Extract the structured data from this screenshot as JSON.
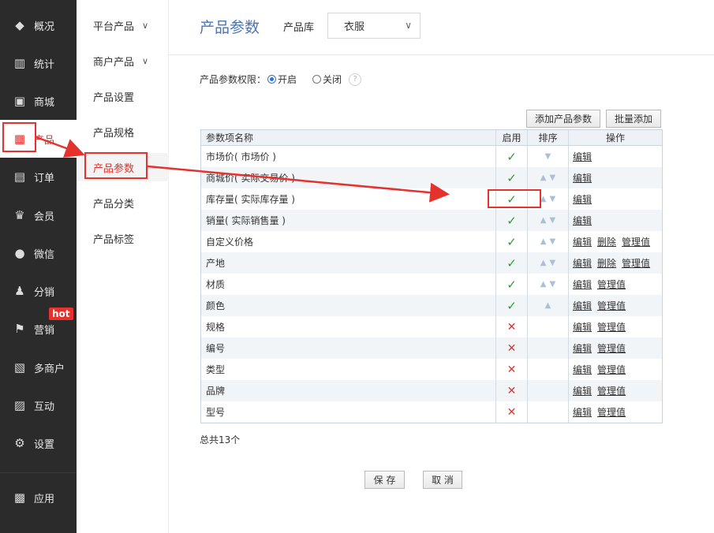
{
  "nav": {
    "items": [
      {
        "label": "概况",
        "icon": "layers-icon",
        "glyph": "◆"
      },
      {
        "label": "统计",
        "icon": "bar-chart-icon",
        "glyph": "▥"
      },
      {
        "label": "商城",
        "icon": "store-icon",
        "glyph": "▣"
      },
      {
        "label": "产品",
        "icon": "grid-icon",
        "glyph": "▦"
      },
      {
        "label": "订单",
        "icon": "order-icon",
        "glyph": "▤"
      },
      {
        "label": "会员",
        "icon": "crown-icon",
        "glyph": "♛"
      },
      {
        "label": "微信",
        "icon": "chat-icon",
        "glyph": "●"
      },
      {
        "label": "分销",
        "icon": "users-icon",
        "glyph": "♟"
      },
      {
        "label": "营销",
        "icon": "flag-icon",
        "glyph": "⚑"
      },
      {
        "label": "多商户",
        "icon": "merchant-icon",
        "glyph": "▧"
      },
      {
        "label": "互动",
        "icon": "interact-icon",
        "glyph": "▨"
      },
      {
        "label": "设置",
        "icon": "gear-icon",
        "glyph": "⚙"
      },
      {
        "label": "应用",
        "icon": "apps-icon",
        "glyph": "▩"
      }
    ],
    "hot_badge": "hot"
  },
  "subnav": {
    "items": [
      {
        "label": "平台产品",
        "chevron": "∨"
      },
      {
        "label": "商户产品",
        "chevron": "∨"
      },
      {
        "label": "产品设置"
      },
      {
        "label": "产品规格"
      },
      {
        "label": "产品参数"
      },
      {
        "label": "产品分类"
      },
      {
        "label": "产品标签"
      }
    ]
  },
  "header": {
    "title": "产品参数",
    "library_label": "产品库",
    "library_value": "衣服",
    "library_chevron": "∨"
  },
  "permission": {
    "label": "产品参数权限：",
    "on_label": "开启",
    "off_label": "关闭",
    "help": "?"
  },
  "toolbar": {
    "add_label": "添加产品参数",
    "batch_label": "批量添加"
  },
  "table": {
    "headers": [
      "参数项名称",
      "启用",
      "排序",
      "操作"
    ],
    "rows": [
      {
        "name": "市场价( 市场价 )",
        "enabled": true,
        "up": false,
        "down": true,
        "actions": [
          "编辑"
        ]
      },
      {
        "name": "商城价( 实际交易价 )",
        "enabled": true,
        "up": true,
        "down": true,
        "actions": [
          "编辑"
        ]
      },
      {
        "name": "库存量( 实际库存量 )",
        "enabled": true,
        "up": true,
        "down": true,
        "actions": [
          "编辑"
        ]
      },
      {
        "name": "销量( 实际销售量 )",
        "enabled": true,
        "up": true,
        "down": true,
        "actions": [
          "编辑"
        ]
      },
      {
        "name": "自定义价格",
        "enabled": true,
        "up": true,
        "down": true,
        "actions": [
          "编辑",
          "删除",
          "管理值"
        ]
      },
      {
        "name": "产地",
        "enabled": true,
        "up": true,
        "down": true,
        "actions": [
          "编辑",
          "删除",
          "管理值"
        ]
      },
      {
        "name": "材质",
        "enabled": true,
        "up": true,
        "down": true,
        "actions": [
          "编辑",
          "管理值"
        ]
      },
      {
        "name": "颜色",
        "enabled": true,
        "up": true,
        "down": false,
        "actions": [
          "编辑",
          "管理值"
        ]
      },
      {
        "name": "规格",
        "enabled": false,
        "up": false,
        "down": false,
        "actions": [
          "编辑",
          "管理值"
        ]
      },
      {
        "name": "编号",
        "enabled": false,
        "up": false,
        "down": false,
        "actions": [
          "编辑",
          "管理值"
        ]
      },
      {
        "name": "类型",
        "enabled": false,
        "up": false,
        "down": false,
        "actions": [
          "编辑",
          "管理值"
        ]
      },
      {
        "name": "品牌",
        "enabled": false,
        "up": false,
        "down": false,
        "actions": [
          "编辑",
          "管理值"
        ]
      },
      {
        "name": "型号",
        "enabled": false,
        "up": false,
        "down": false,
        "actions": [
          "编辑",
          "管理值"
        ]
      }
    ],
    "check_glyph": "✓",
    "cross_glyph": "✕",
    "up_glyph": "▲",
    "down_glyph": "▼"
  },
  "footer": {
    "total": "总共13个",
    "save_label": "保 存",
    "cancel_label": "取 消"
  },
  "colors": {
    "nav_bg": "#2b2b2b",
    "accent_red": "#e5322d",
    "title_blue": "#4a74b8",
    "check_green": "#2e9c2e"
  }
}
